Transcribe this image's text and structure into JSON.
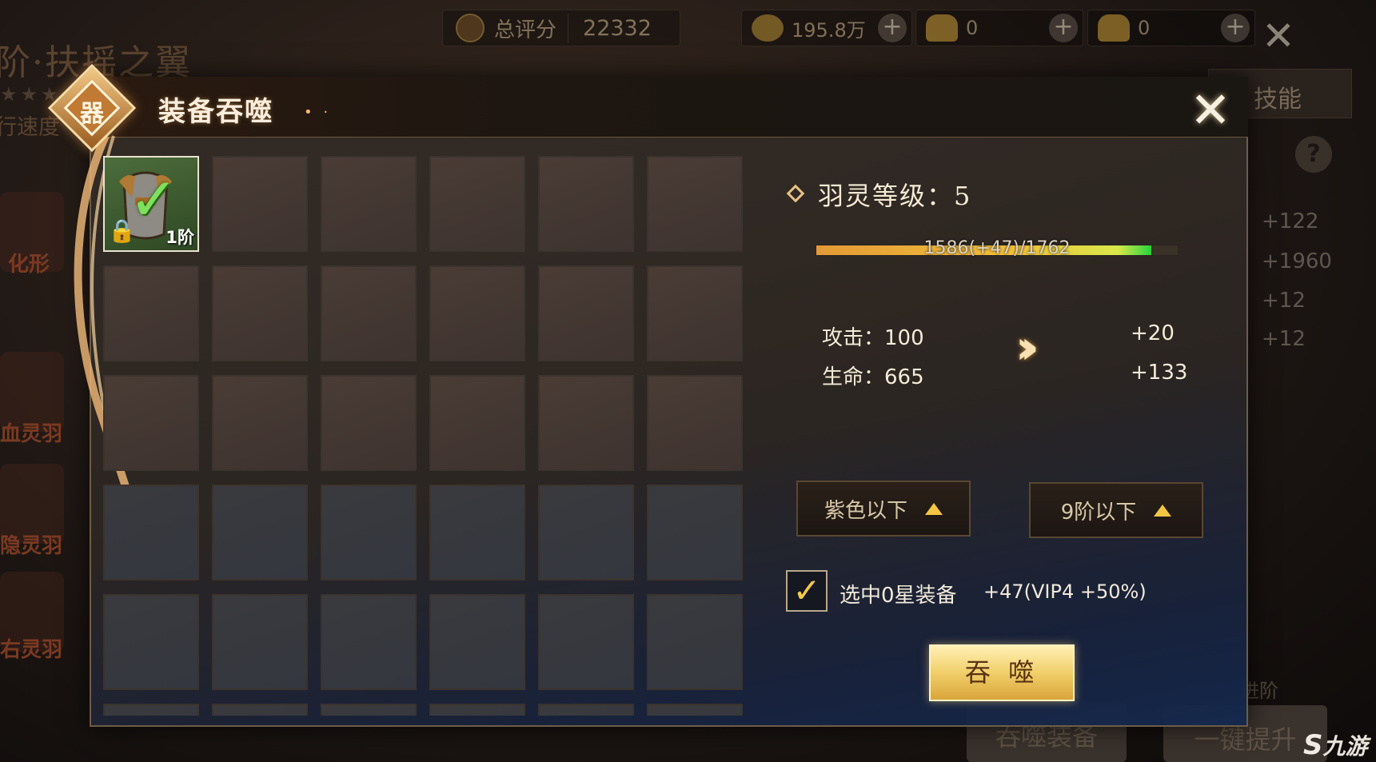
{
  "topbar": {
    "score_label": "总评分",
    "score_value": "22332",
    "currencies": [
      {
        "icon": "copper-coin-icon",
        "value": "195.8万"
      },
      {
        "icon": "bound-gold-ingot-icon",
        "value": "0"
      },
      {
        "icon": "gold-ingot-icon",
        "value": "0"
      }
    ],
    "plus_symbol": "+",
    "close_symbol": "✕"
  },
  "background": {
    "wing_title": "阶·扶摇之翼",
    "stars": "★★★★",
    "speed_label": "行速度",
    "skill_tab": "技能",
    "help_symbol": "?",
    "stats": [
      "+122",
      "+1960",
      "+12",
      "+12"
    ],
    "side_labels": [
      "化形",
      "血灵羽",
      "隐灵羽",
      "右灵羽"
    ],
    "btn_devour_equip": "吞噬装备",
    "btn_one_key": "一键提升",
    "jinjie": "进阶"
  },
  "dialog": {
    "title": "装备吞噬",
    "emblem_glyph": "器",
    "close_symbol": "✕",
    "grid": {
      "columns": 6,
      "visible_rows": 6,
      "items": [
        {
          "name": "armor",
          "rank": "1阶",
          "selected": true,
          "locked": true
        }
      ]
    },
    "level": {
      "label": "羽灵等级：5",
      "current": 1586,
      "gain": 47,
      "max": 1762,
      "progress_text": "1586(+47)/1762"
    },
    "stats": [
      {
        "label": "攻击：100",
        "bonus": "+20"
      },
      {
        "label": "生命：665",
        "bonus": "+133"
      }
    ],
    "arrow_symbol": "››",
    "filters": [
      {
        "label": "紫色以下"
      },
      {
        "label": "9阶以下"
      }
    ],
    "select_zero_star": {
      "checked": true,
      "check_symbol": "✓",
      "label": "选中0星装备",
      "bonus": "+47(VIP4 +50%)"
    },
    "devour_button": "吞 噬"
  },
  "watermark": {
    "mark": "S",
    "text": "九游"
  },
  "colors": {
    "accent_gold": "#f2c644",
    "progress_green": "#28d33b",
    "check_green": "#7ee15e",
    "title_text": "#fbeede"
  }
}
